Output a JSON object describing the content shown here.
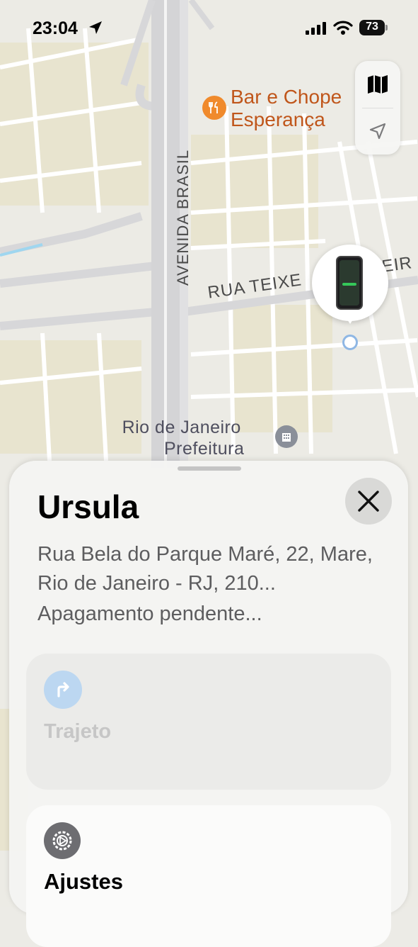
{
  "status_bar": {
    "time": "23:04",
    "battery_level": "73",
    "icons": [
      "location-arrow-icon",
      "signal-icon",
      "wifi-icon",
      "battery-icon"
    ]
  },
  "map": {
    "labels": {
      "avenue": "AVENIDA BRASIL",
      "street": "RUA TEIXE",
      "street_end": "EIR",
      "landmark_line1": "Rio de Janeiro",
      "landmark_line2": "Prefeitura",
      "poi_line1": "Bar e Chope",
      "poi_line2": "Esperança"
    },
    "poi_icon": "fork-knife-icon",
    "landmark_icon": "government-building-icon"
  },
  "map_controls": {
    "icons": [
      "map-icon",
      "location-arrow-icon"
    ]
  },
  "device_pin": {
    "icon": "iphone-icon"
  },
  "sheet": {
    "title": "Ursula",
    "address": "Rua Bela do Parque Maré, 22, Mare, Rio de Janeiro - RJ, 210...",
    "status": "Apagamento pendente...",
    "actions": {
      "route_label": "Trajeto",
      "settings_label": "Ajustes"
    },
    "colors": {
      "accent_blue": "#bcd7f1",
      "poi_orange": "#f08a2c"
    }
  }
}
